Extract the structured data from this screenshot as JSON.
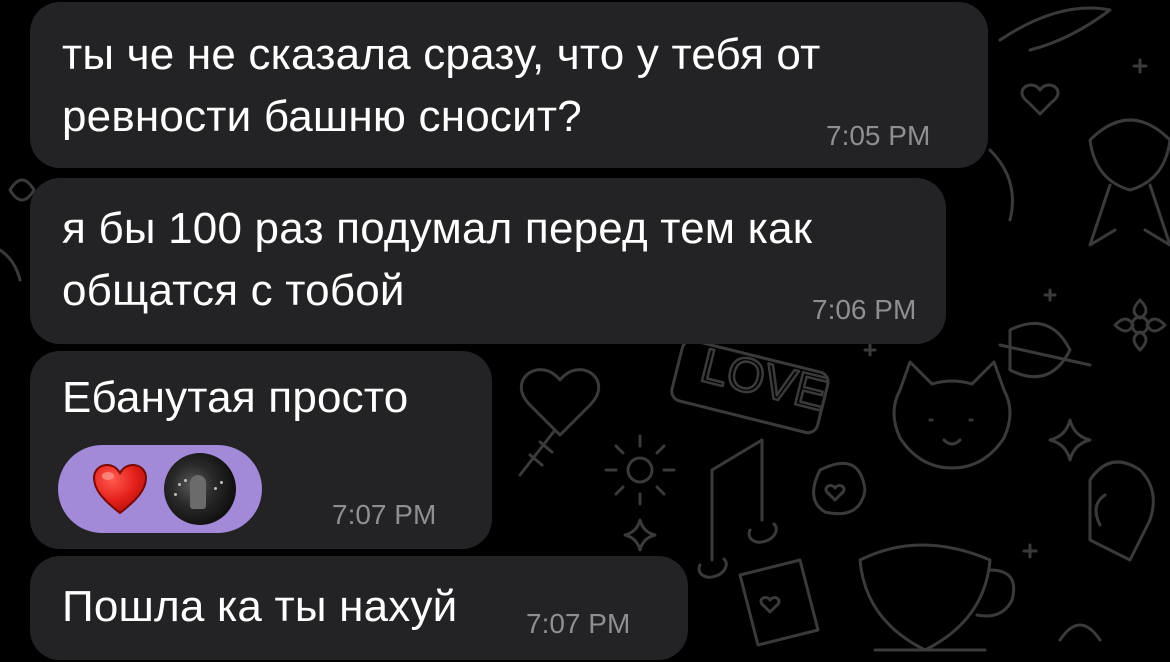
{
  "messages": [
    {
      "text": "ты че не сказала сразу, что у тебя от\nревности башню сносит?",
      "time": "7:05 PM"
    },
    {
      "text": "я бы 100 раз подумал перед тем как\nобщатся с тобой",
      "time": "7:06 PM"
    },
    {
      "text": "Ебанутая просто",
      "time": "7:07 PM",
      "reaction": {
        "emoji_icon": "red-heart-icon",
        "reactor": "avatar",
        "color": "#a28ad9"
      }
    },
    {
      "text": "Пошла ка ты нахуй",
      "time": "7:07 PM"
    }
  ],
  "wallpaper": {
    "doodle_text": "LOVE",
    "color": "#3a3a3c"
  },
  "colors": {
    "background": "#000000",
    "bubble": "#232325",
    "text": "#ffffff",
    "time": "#8e8e93",
    "heart": "#e3201b"
  }
}
